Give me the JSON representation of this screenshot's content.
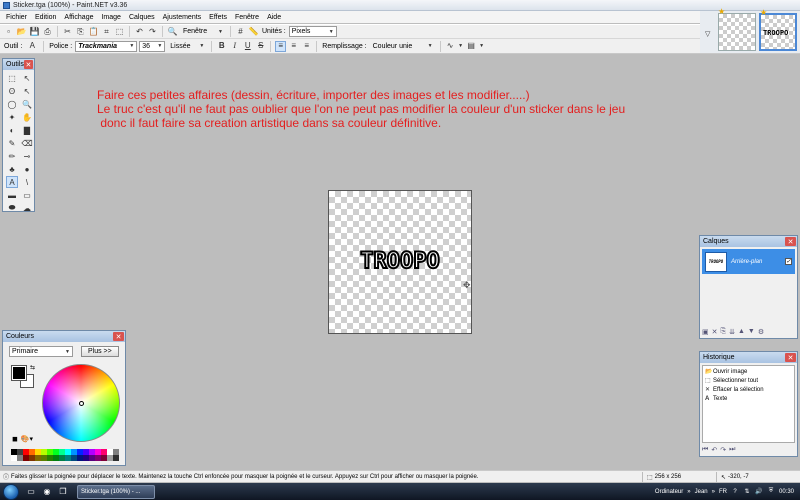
{
  "window": {
    "title": "Sticker.tga (100%) - Paint.NET v3.36"
  },
  "menu": [
    "Fichier",
    "Edition",
    "Affichage",
    "Image",
    "Calques",
    "Ajustements",
    "Effets",
    "Fenêtre",
    "Aide"
  ],
  "toolbar1": {
    "window_label": "Fenêtre",
    "units_label": "Unités :",
    "units_value": "Pixels"
  },
  "toolbar2": {
    "tool_label": "Outil :",
    "tool_value": "A",
    "font_label": "Police :",
    "font_value": "Trackmania",
    "size_value": "36",
    "smoothing_value": "Lissée",
    "fill_label": "Remplissage :",
    "fill_value": "Couleur unie"
  },
  "canvas": {
    "annotation": "Faire ces petites affaires (dessin, écriture, importer des images et les modifier.....)\nLe truc c'est qu'il ne faut pas oublier que l'on ne peut pas modifier la couleur d'un sticker dans le jeu\n donc il faut faire sa creation artistique dans sa couleur définitive.",
    "logo_text": "TROOPO"
  },
  "thumbnails": {
    "logo_text": "TROOPO"
  },
  "tools_panel": {
    "title": "Outils"
  },
  "colors_panel": {
    "title": "Couleurs",
    "mode_value": "Primaire",
    "more_button": "Plus >>",
    "primary_color": "#000000",
    "secondary_color": "#ffffff",
    "palette": [
      "#000000",
      "#404040",
      "#ff0000",
      "#ff6a00",
      "#ffd800",
      "#b6ff00",
      "#4cff00",
      "#00ff21",
      "#00ff90",
      "#00ffff",
      "#0094ff",
      "#0026ff",
      "#4800ff",
      "#b200ff",
      "#ff00dc",
      "#ff006e",
      "#ffffff",
      "#808080",
      "#ffffff",
      "#808080",
      "#7f0000",
      "#7f3300",
      "#7f6a00",
      "#5b7f00",
      "#267f00",
      "#007f0e",
      "#007f46",
      "#007f7f",
      "#004a7f",
      "#00137f",
      "#21007f",
      "#57007f",
      "#7f006e",
      "#7f0037",
      "#a0a0a0",
      "#303030"
    ]
  },
  "layers_panel": {
    "title": "Calques",
    "layer_name": "Arrière-plan",
    "layer_thumb_text": "TROOPO"
  },
  "history_panel": {
    "title": "Historique",
    "items": [
      {
        "icon": "open-image-icon",
        "label": "Ouvrir image"
      },
      {
        "icon": "select-all-icon",
        "label": "Sélectionner tout"
      },
      {
        "icon": "erase-selection-icon",
        "label": "Effacer la sélection"
      },
      {
        "icon": "text-icon",
        "label": "Texte"
      }
    ]
  },
  "status": {
    "hint": "Faites glisser la poignée pour déplacer le texte. Maintenez la touche Ctrl enfoncée pour masquer la poignée et le curseur. Appuyez sur Ctrl pour afficher ou masquer la poignée.",
    "image_size": "256 x 256",
    "cursor_pos": "-320, -7"
  },
  "taskbar": {
    "task_label": "Sticker.tga (100%) - ...",
    "computer_label": "Ordinateur",
    "user_label": "Jean",
    "lang": "FR",
    "clock": "00:30"
  }
}
